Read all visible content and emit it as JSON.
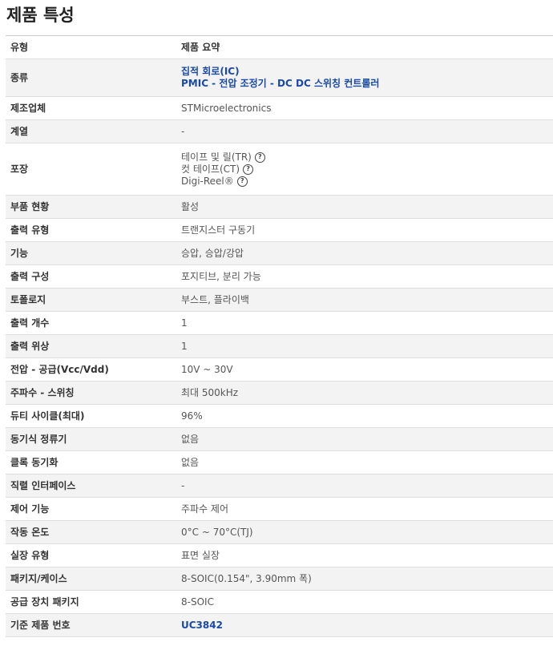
{
  "title": "제품 특성",
  "header": {
    "type": "유형",
    "summary": "제품 요약"
  },
  "category": {
    "label": "종류",
    "links": [
      "집적 회로(IC)",
      "PMIC - 전압 조정기 - DC DC 스위칭 컨트롤러"
    ]
  },
  "manufacturer": {
    "label": "제조업체",
    "value": "STMicroelectronics"
  },
  "series": {
    "label": "계열",
    "value": "-"
  },
  "packaging": {
    "label": "포장",
    "options": [
      "테이프 및 릴(TR)",
      "컷 테이프(CT)",
      "Digi-Reel®"
    ]
  },
  "rows": [
    {
      "label": "부품 현황",
      "value": "활성"
    },
    {
      "label": "출력 유형",
      "value": "트랜지스터 구동기"
    },
    {
      "label": "기능",
      "value": "승압, 승압/강압"
    },
    {
      "label": "출력 구성",
      "value": "포지티브, 분리 가능"
    },
    {
      "label": "토폴로지",
      "value": "부스트, 플라이백"
    },
    {
      "label": "출력 개수",
      "value": "1"
    },
    {
      "label": "출력 위상",
      "value": "1"
    },
    {
      "label": "전압 - 공급(Vcc/Vdd)",
      "value": "10V ~ 30V"
    },
    {
      "label": "주파수 - 스위칭",
      "value": "최대 500kHz"
    },
    {
      "label": "듀티 사이클(최대)",
      "value": "96%"
    },
    {
      "label": "동기식 정류기",
      "value": "없음"
    },
    {
      "label": "클록 동기화",
      "value": "없음"
    },
    {
      "label": "직렬 인터페이스",
      "value": "-"
    },
    {
      "label": "제어 기능",
      "value": "주파수 제어"
    },
    {
      "label": "작동 온도",
      "value": "0°C ~ 70°C(TJ)"
    },
    {
      "label": "실장 유형",
      "value": "표면 실장"
    },
    {
      "label": "패키지/케이스",
      "value": "8-SOIC(0.154\", 3.90mm 폭)"
    },
    {
      "label": "공급 장치 패키지",
      "value": "8-SOIC"
    }
  ],
  "base_part": {
    "label": "기준 제품 번호",
    "value": "UC3842"
  },
  "help_glyph": "?",
  "colors": {
    "link": "#1a4aa6",
    "stripe": "#f3f3f3"
  }
}
